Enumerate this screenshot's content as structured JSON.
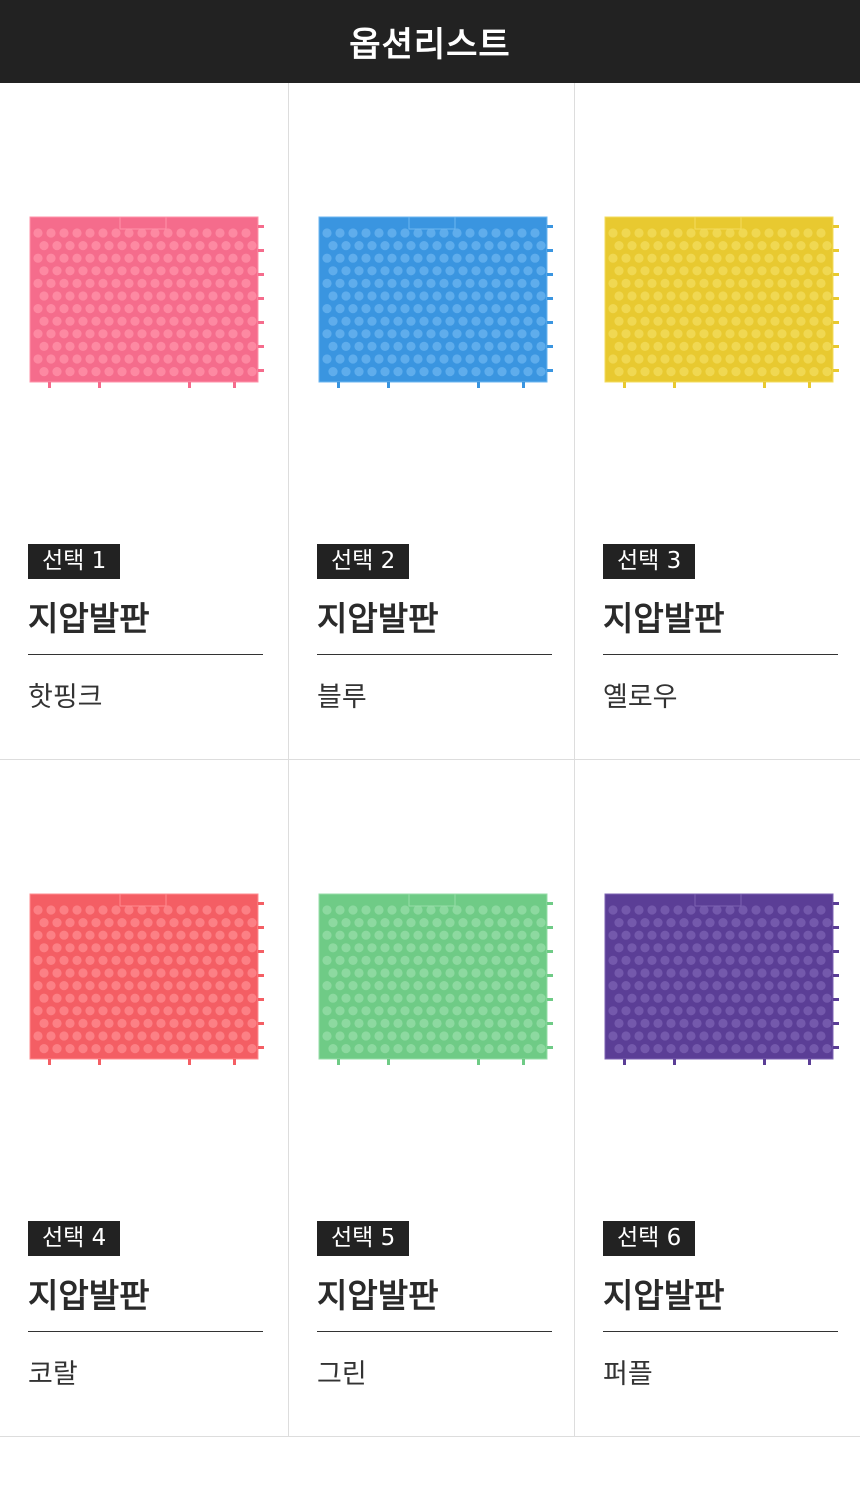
{
  "header": {
    "title": "옵션리스트"
  },
  "options": [
    {
      "badge": "선택 1",
      "name": "지압발판",
      "color_name": "핫핑크",
      "color": "#f56c8c",
      "dot": "#ff93aa",
      "icon": "foot-massage-mat-hotpink-icon"
    },
    {
      "badge": "선택 2",
      "name": "지압발판",
      "color_name": "블루",
      "color": "#3a95e0",
      "dot": "#6cb6f0",
      "icon": "foot-massage-mat-blue-icon"
    },
    {
      "badge": "선택 3",
      "name": "지압발판",
      "color_name": "옐로우",
      "color": "#e8c930",
      "dot": "#f3dc5e",
      "icon": "foot-massage-mat-yellow-icon"
    },
    {
      "badge": "선택 4",
      "name": "지압발판",
      "color_name": "코랄",
      "color": "#f45e64",
      "dot": "#ff8c90",
      "icon": "foot-massage-mat-coral-icon"
    },
    {
      "badge": "선택 5",
      "name": "지압발판",
      "color_name": "그린",
      "color": "#6fcb86",
      "dot": "#97dda8",
      "icon": "foot-massage-mat-green-icon"
    },
    {
      "badge": "선택 6",
      "name": "지압발판",
      "color_name": "퍼플",
      "color": "#5b3e96",
      "dot": "#7c63b3",
      "icon": "foot-massage-mat-purple-icon"
    }
  ]
}
